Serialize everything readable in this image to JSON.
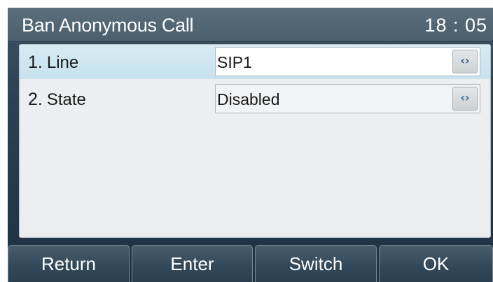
{
  "header": {
    "title": "Ban Anonymous Call",
    "time": "18 : 05"
  },
  "settings": [
    {
      "number": "1.",
      "label": "Line",
      "value": "SIP1",
      "control_icon": "switch-arrows-icon",
      "control_glyph": "‹›"
    },
    {
      "number": "2.",
      "label": "State",
      "value": "Disabled",
      "control_icon": "switch-arrows-icon",
      "control_glyph": "‹›"
    }
  ],
  "softkeys": [
    {
      "label": "Return"
    },
    {
      "label": "Enter"
    },
    {
      "label": "Switch"
    },
    {
      "label": "OK"
    }
  ],
  "colors": {
    "accent_selected_row": "#c7e2ee",
    "titlebar": "#4a5e6c",
    "background": "#23394a"
  }
}
